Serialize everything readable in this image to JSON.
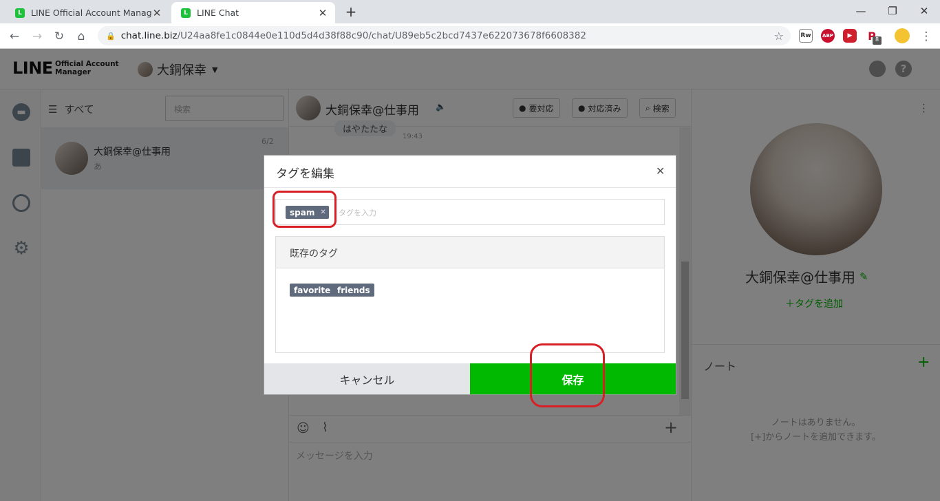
{
  "browser": {
    "tabs": [
      {
        "title": "LINE Official Account Manager",
        "active": false
      },
      {
        "title": "LINE Chat",
        "active": true
      }
    ],
    "new_tab": "+",
    "url_host": "chat.line.biz",
    "url_path": "/U24aa8fe1c0844e0e110d5d4d38f88c90/chat/U89eb5c2bcd7437e622073678f6608382",
    "extensions": [
      "ABP",
      "8"
    ]
  },
  "header": {
    "logo": "LINE",
    "logo_sub_1": "Official Account",
    "logo_sub_2": "Manager",
    "account_name": "大銅保幸"
  },
  "list": {
    "filter_label": "すべて",
    "search_placeholder": "検索",
    "items": [
      {
        "name": "大銅保幸@仕事用",
        "preview": "あ",
        "date": "6/2"
      }
    ]
  },
  "chat": {
    "title": "大銅保幸@仕事用",
    "btn_needs_action": "要対応",
    "btn_done": "対応済み",
    "btn_search": "検索",
    "bubble_text": "はやたたな",
    "bubble_time": "19:43",
    "composer_placeholder": "メッセージを入力"
  },
  "profile": {
    "name": "大銅保幸@仕事用",
    "add_tag": "＋タグを追加",
    "notes_title": "ノート",
    "notes_empty_1": "ノートはありません。",
    "notes_empty_2": "[+]からノートを追加できます。"
  },
  "modal": {
    "title": "タグを編集",
    "selected_tags": [
      "spam"
    ],
    "tag_input_placeholder": "タグを入力",
    "existing_header": "既存のタグ",
    "existing_tags": [
      "favorite",
      "friends"
    ],
    "cancel_label": "キャンセル",
    "save_label": "保存"
  },
  "colors": {
    "line_green": "#00b900",
    "tag_gray": "#5f6a7d",
    "highlight_red": "#d81f26"
  }
}
